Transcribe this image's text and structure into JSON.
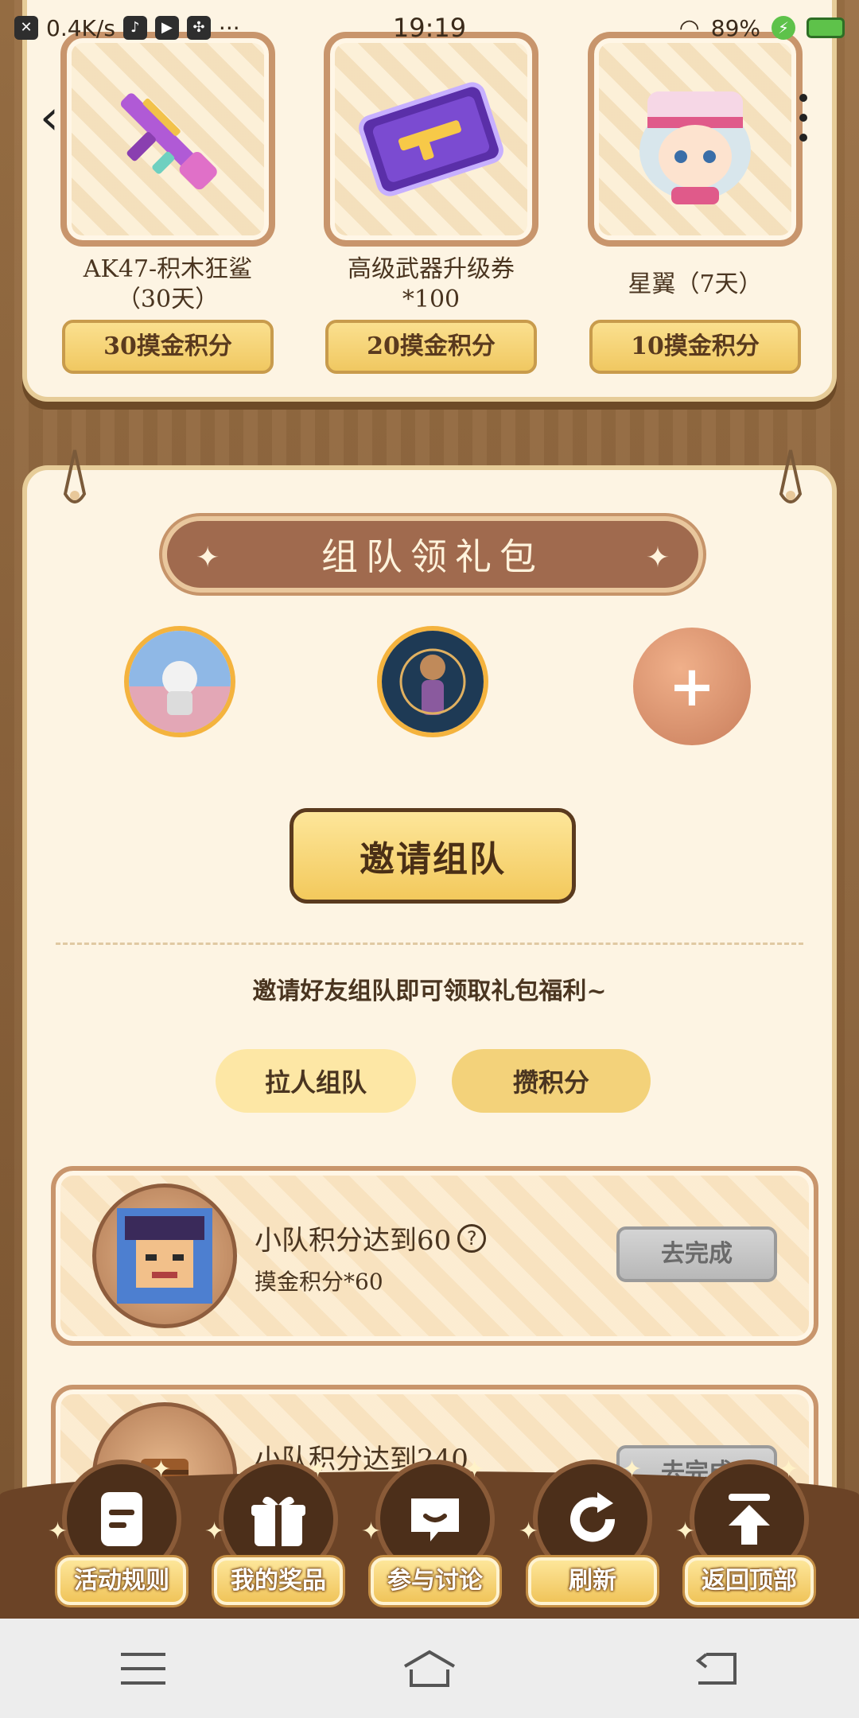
{
  "status_bar": {
    "speed": "0.4K/s",
    "time": "19:19",
    "battery": "89%",
    "more": "···"
  },
  "prizes": [
    {
      "name_line1": "AK47-积木狂鲨",
      "name_line2": "（30天）",
      "price": "30摸金积分",
      "icon": "ak47-gun-icon"
    },
    {
      "name_line1": "高级武器升级券",
      "name_line2": "*100",
      "price": "20摸金积分",
      "icon": "weapon-upgrade-ticket-icon"
    },
    {
      "name_line1": "星翼（7天）",
      "name_line2": "",
      "price": "10摸金积分",
      "icon": "character-avatar-icon"
    }
  ],
  "team": {
    "banner_title": "组队领礼包",
    "invite_button": "邀请组队",
    "hint": "邀请好友组队即可领取礼包福利~",
    "pill_left": "拉人组队",
    "pill_right": "攒积分",
    "add_symbol": "+"
  },
  "tasks": [
    {
      "title": "小队积分达到60",
      "reward": "摸金积分*60",
      "button": "去完成",
      "help": "?"
    },
    {
      "title": "小队积分达到240",
      "reward": "",
      "button": "去完成",
      "help": ""
    }
  ],
  "dock": [
    {
      "label": "活动规则",
      "icon": "document-icon"
    },
    {
      "label": "我的奖品",
      "icon": "gift-icon"
    },
    {
      "label": "参与讨论",
      "icon": "chat-icon"
    },
    {
      "label": "刷新",
      "icon": "refresh-icon"
    },
    {
      "label": "返回顶部",
      "icon": "back-to-top-icon"
    }
  ],
  "colors": {
    "card_bg": "#fdf4e3",
    "accent_gold": "#f3c95c",
    "banner_brown": "#a06a4e",
    "dock_brown": "#6b4326"
  }
}
